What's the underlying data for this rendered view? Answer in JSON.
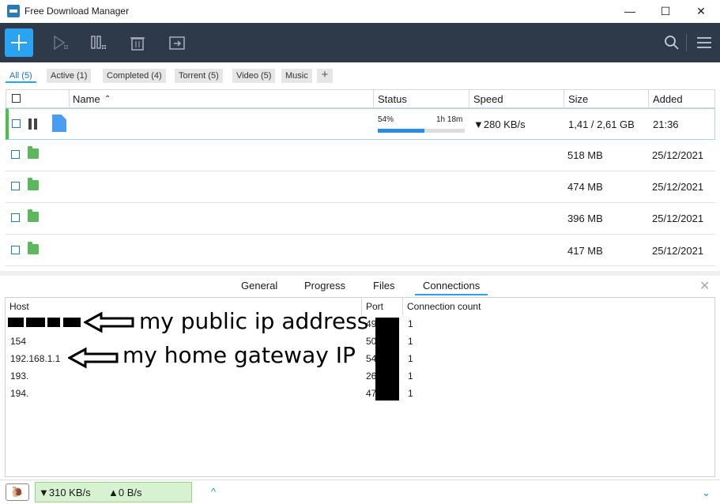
{
  "window": {
    "title": "Free Download Manager",
    "minimize": "—",
    "maximize": "☐",
    "close": "✕"
  },
  "toolbar": {
    "icons": [
      "add-icon",
      "resume-icon",
      "pause-all-icon",
      "delete-icon",
      "move-to-icon",
      "search-icon",
      "menu-icon"
    ]
  },
  "filters": [
    {
      "label": "All (5)",
      "active": true
    },
    {
      "label": "Active (1)"
    },
    {
      "label": "Completed (4)"
    },
    {
      "label": "Torrent (5)"
    },
    {
      "label": "Video (5)"
    },
    {
      "label": "Music"
    }
  ],
  "filter_add": "+",
  "grid": {
    "headers": {
      "name": "Name",
      "sort_arrow": "⌃",
      "status": "Status",
      "speed": "Speed",
      "size": "Size",
      "added": "Added"
    },
    "rows": [
      {
        "progress_pct": "54%",
        "progress_value": 54,
        "remaining": "1h 18m",
        "speed": "▼280 KB/s",
        "size": "1,41 / 2,61 GB",
        "added": "21:36",
        "state": "downloading"
      },
      {
        "size": "518 MB",
        "added": "25/12/2021"
      },
      {
        "size": "474 MB",
        "added": "25/12/2021"
      },
      {
        "size": "396 MB",
        "added": "25/12/2021"
      },
      {
        "size": "417 MB",
        "added": "25/12/2021"
      }
    ]
  },
  "details": {
    "tabs": [
      "General",
      "Progress",
      "Files",
      "Connections"
    ],
    "active_tab": "Connections",
    "close": "✕",
    "columns": {
      "host": "Host",
      "port": "Port",
      "count": "Connection count"
    },
    "rows": [
      {
        "host": "",
        "port": "49",
        "count": "1"
      },
      {
        "host": "154",
        "port": "50",
        "count": "1"
      },
      {
        "host": "192.168.1.1",
        "port": "54",
        "count": "1"
      },
      {
        "host": "193.",
        "port": "26",
        "count": "1"
      },
      {
        "host": "194.",
        "port": "47",
        "count": "1"
      }
    ],
    "annotations": {
      "public_ip": "my public ip address",
      "gateway_ip": "my home gateway IP"
    }
  },
  "statusbar": {
    "down": "▼310 KB/s",
    "up": "▲0 B/s",
    "chevron_up": "^",
    "chevron_down": "⌄"
  }
}
